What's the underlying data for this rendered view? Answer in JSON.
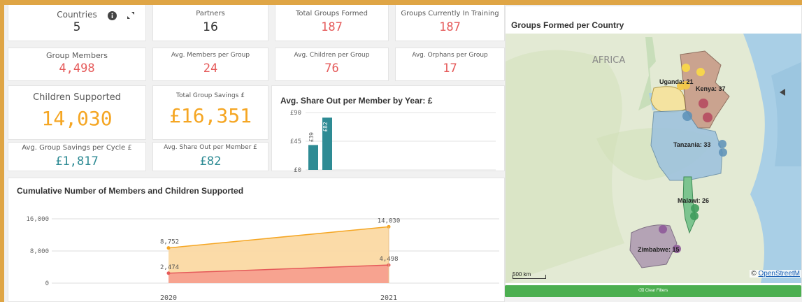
{
  "colors": {
    "frame": "#dfa545",
    "red": "#e55a5a",
    "orange": "#f5a623",
    "teal": "#2e8b94",
    "children_area": "#fbd9a3",
    "members_area": "#f7a08e",
    "green_button": "#4caf50"
  },
  "kpis": {
    "countries": {
      "label": "Countries",
      "value": "5"
    },
    "partners": {
      "label": "Partners",
      "value": "16"
    },
    "groups_formed": {
      "label": "Total Groups Formed",
      "value": "187"
    },
    "groups_training": {
      "label": "Groups Currently In Training",
      "value": "187"
    },
    "group_members": {
      "label": "Group Members",
      "value": "4,498"
    },
    "avg_members": {
      "label": "Avg. Members per Group",
      "value": "24"
    },
    "avg_children": {
      "label": "Avg. Children per Group",
      "value": "76"
    },
    "avg_orphans": {
      "label": "Avg. Orphans per Group",
      "value": "17"
    },
    "children_supported": {
      "label": "Children Supported",
      "value": "14,030"
    },
    "total_savings": {
      "label": "Total Group Savings £",
      "value": "£16,351"
    },
    "avg_savings_cycle": {
      "label": "Avg. Group Savings per Cycle £",
      "value": "£1,817"
    },
    "avg_share_out": {
      "label": "Avg. Share Out per Member £",
      "value": "£82"
    }
  },
  "icons": {
    "info": "info-icon",
    "expand": "expand-icon",
    "collapse": "collapse-arrow-icon",
    "clear": "clear-filters-icon"
  },
  "bar_chart_title": "Avg. Share Out per Member by Year: £",
  "area_chart_title": "Cumulative Number of Members and Children Supported",
  "map": {
    "title": "Groups Formed per Country",
    "continent_label": "AFRICA",
    "country_labels": [
      {
        "name": "Uganda: 21"
      },
      {
        "name": "Kenya: 37"
      },
      {
        "name": "Tanzania: 33"
      },
      {
        "name": "Malawi: 26"
      },
      {
        "name": "Zimbabwe: 15"
      }
    ],
    "scale_label": "500 km",
    "attribution_prefix": "© ",
    "attribution_link": "OpenStreetM"
  },
  "clear_filters_label": "Clear Filters",
  "chart_data": [
    {
      "type": "bar",
      "title": "Avg. Share Out per Member by Year: £",
      "categories": [
        "",
        ""
      ],
      "values": [
        39,
        82
      ],
      "data_labels": [
        "£39",
        "£82"
      ],
      "y_ticks": [
        "£0",
        "£45",
        "£90"
      ],
      "ylim": [
        0,
        90
      ],
      "grid": true
    },
    {
      "type": "area",
      "title": "Cumulative Number of Members and Children Supported",
      "categories": [
        "2020",
        "2021"
      ],
      "series": [
        {
          "values": [
            8752,
            14030
          ],
          "labels": [
            "8,752",
            "14,030"
          ],
          "color": "#f5a623"
        },
        {
          "values": [
            2474,
            4498
          ],
          "labels": [
            "2,474",
            "4,498"
          ],
          "color": "#e55a5a"
        }
      ],
      "y_ticks": [
        "0",
        "8,000",
        "16,000"
      ],
      "ylim": [
        0,
        16000
      ],
      "grid": true
    }
  ]
}
